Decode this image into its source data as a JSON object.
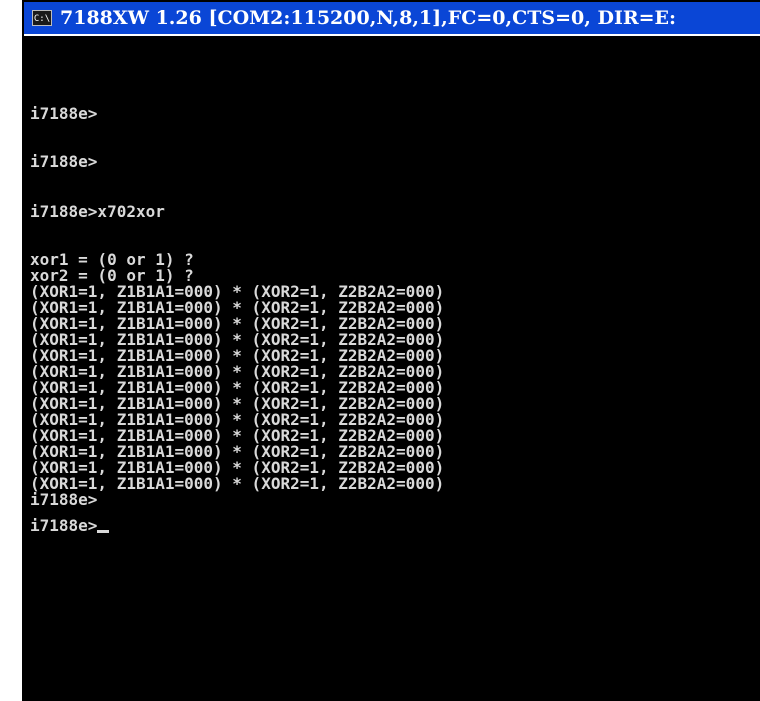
{
  "window": {
    "icon_label": "C:\\",
    "title": "7188XW 1.26 [COM2:115200,N,8,1],FC=0,CTS=0, DIR=E:"
  },
  "console": {
    "lines": [
      "i7188e>",
      "i7188e>",
      "i7188e>x702xor",
      "xor1 = (0 or 1) ?",
      "xor2 = (0 or 1) ?",
      "(XOR1=1, Z1B1A1=000) * (XOR2=1, Z2B2A2=000)",
      "(XOR1=1, Z1B1A1=000) * (XOR2=1, Z2B2A2=000)",
      "(XOR1=1, Z1B1A1=000) * (XOR2=1, Z2B2A2=000)",
      "(XOR1=1, Z1B1A1=000) * (XOR2=1, Z2B2A2=000)",
      "(XOR1=1, Z1B1A1=000) * (XOR2=1, Z2B2A2=000)",
      "(XOR1=1, Z1B1A1=000) * (XOR2=1, Z2B2A2=000)",
      "(XOR1=1, Z1B1A1=000) * (XOR2=1, Z2B2A2=000)",
      "(XOR1=1, Z1B1A1=000) * (XOR2=1, Z2B2A2=000)",
      "(XOR1=1, Z1B1A1=000) * (XOR2=1, Z2B2A2=000)",
      "(XOR1=1, Z1B1A1=000) * (XOR2=1, Z2B2A2=000)",
      "(XOR1=1, Z1B1A1=000) * (XOR2=1, Z2B2A2=000)",
      "(XOR1=1, Z1B1A1=000) * (XOR2=1, Z2B2A2=000)",
      "(XOR1=1, Z1B1A1=000) * (XOR2=1, Z2B2A2=000)",
      "i7188e>",
      "i7188e>"
    ]
  },
  "icons": {
    "system_menu": "console-window-icon",
    "pointer_left": "up-arrow-icon",
    "pointer_right": "up-arrow-icon"
  }
}
